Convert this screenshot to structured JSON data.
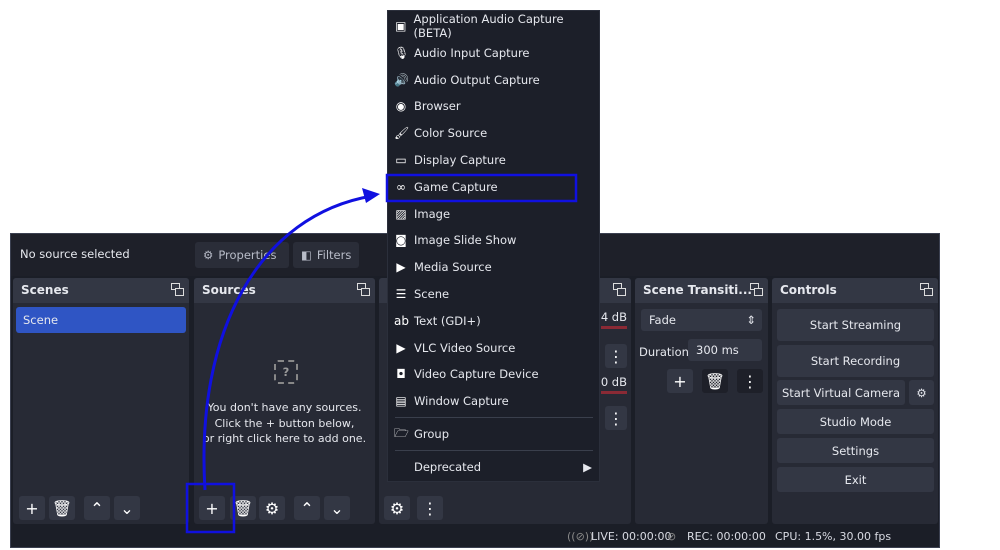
{
  "topbar": {
    "no_source": "No source selected",
    "properties": "Properties",
    "filters": "Filters"
  },
  "scenes": {
    "title": "Scenes",
    "items": [
      "Scene"
    ]
  },
  "sources": {
    "title": "Sources",
    "empty_lines": [
      "You don't have any sources.",
      "Click the + button below,",
      "or right click here to add one."
    ]
  },
  "mixer": {
    "db1": ".4 dB",
    "db2": ".0 dB"
  },
  "transitions": {
    "title": "Scene Transiti...",
    "selected": "Fade",
    "duration_label": "Duration",
    "duration_value": "300 ms"
  },
  "controls": {
    "title": "Controls",
    "buttons": [
      "Start Streaming",
      "Start Recording",
      "Start Virtual Camera",
      "Studio Mode",
      "Settings",
      "Exit"
    ]
  },
  "status": {
    "live": "LIVE: 00:00:00",
    "rec": "REC: 00:00:00",
    "cpu": "CPU: 1.5%, 30.00 fps"
  },
  "menu": {
    "items": [
      {
        "label": "Application Audio Capture (BETA)",
        "icon": "app-audio-icon"
      },
      {
        "label": "Audio Input Capture",
        "icon": "microphone-icon"
      },
      {
        "label": "Audio Output Capture",
        "icon": "speaker-icon"
      },
      {
        "label": "Browser",
        "icon": "globe-icon"
      },
      {
        "label": "Color Source",
        "icon": "brush-icon"
      },
      {
        "label": "Display Capture",
        "icon": "monitor-icon"
      },
      {
        "label": "Game Capture",
        "icon": "gamepad-icon"
      },
      {
        "label": "Image",
        "icon": "image-icon"
      },
      {
        "label": "Image Slide Show",
        "icon": "slideshow-icon"
      },
      {
        "label": "Media Source",
        "icon": "play-icon"
      },
      {
        "label": "Scene",
        "icon": "list-icon"
      },
      {
        "label": "Text (GDI+)",
        "icon": "text-icon"
      },
      {
        "label": "VLC Video Source",
        "icon": "play-icon"
      },
      {
        "label": "Video Capture Device",
        "icon": "camera-icon"
      },
      {
        "label": "Window Capture",
        "icon": "window-icon"
      }
    ],
    "group": "Group",
    "deprecated": "Deprecated"
  },
  "colors": {
    "accent": "#2f55c4",
    "annotation": "#1010e0"
  }
}
